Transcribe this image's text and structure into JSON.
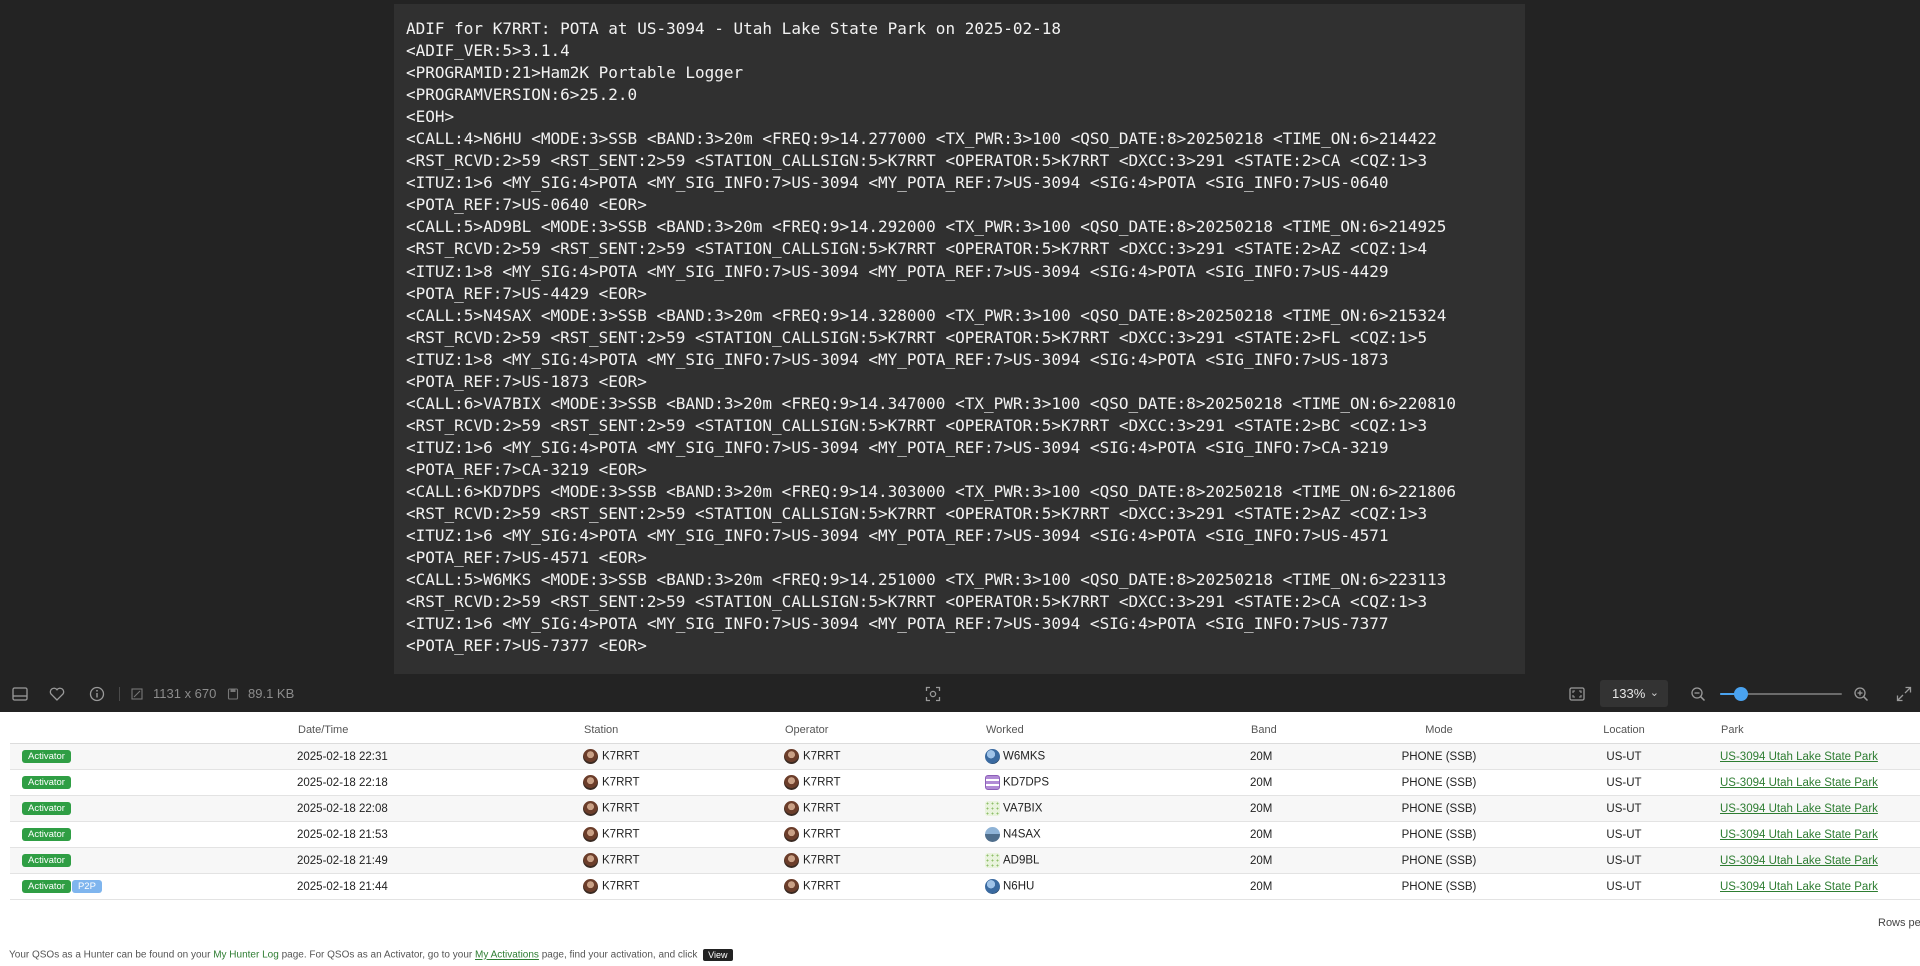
{
  "adif_lines": [
    "ADIF for K7RRT: POTA at US-3094 - Utah Lake State Park on 2025-02-18",
    "<ADIF_VER:5>3.1.4",
    "<PROGRAMID:21>Ham2K Portable Logger",
    "<PROGRAMVERSION:6>25.2.0",
    "<EOH>",
    "<CALL:4>N6HU <MODE:3>SSB <BAND:3>20m <FREQ:9>14.277000 <TX_PWR:3>100 <QSO_DATE:8>20250218 <TIME_ON:6>214422",
    "<RST_RCVD:2>59 <RST_SENT:2>59 <STATION_CALLSIGN:5>K7RRT <OPERATOR:5>K7RRT <DXCC:3>291 <STATE:2>CA <CQZ:1>3",
    "<ITUZ:1>6 <MY_SIG:4>POTA <MY_SIG_INFO:7>US-3094 <MY_POTA_REF:7>US-3094 <SIG:4>POTA <SIG_INFO:7>US-0640",
    "<POTA_REF:7>US-0640 <EOR>",
    "<CALL:5>AD9BL <MODE:3>SSB <BAND:3>20m <FREQ:9>14.292000 <TX_PWR:3>100 <QSO_DATE:8>20250218 <TIME_ON:6>214925",
    "<RST_RCVD:2>59 <RST_SENT:2>59 <STATION_CALLSIGN:5>K7RRT <OPERATOR:5>K7RRT <DXCC:3>291 <STATE:2>AZ <CQZ:1>4",
    "<ITUZ:1>8 <MY_SIG:4>POTA <MY_SIG_INFO:7>US-3094 <MY_POTA_REF:7>US-3094 <SIG:4>POTA <SIG_INFO:7>US-4429",
    "<POTA_REF:7>US-4429 <EOR>",
    "<CALL:5>N4SAX <MODE:3>SSB <BAND:3>20m <FREQ:9>14.328000 <TX_PWR:3>100 <QSO_DATE:8>20250218 <TIME_ON:6>215324",
    "<RST_RCVD:2>59 <RST_SENT:2>59 <STATION_CALLSIGN:5>K7RRT <OPERATOR:5>K7RRT <DXCC:3>291 <STATE:2>FL <CQZ:1>5",
    "<ITUZ:1>8 <MY_SIG:4>POTA <MY_SIG_INFO:7>US-3094 <MY_POTA_REF:7>US-3094 <SIG:4>POTA <SIG_INFO:7>US-1873",
    "<POTA_REF:7>US-1873 <EOR>",
    "<CALL:6>VA7BIX <MODE:3>SSB <BAND:3>20m <FREQ:9>14.347000 <TX_PWR:3>100 <QSO_DATE:8>20250218 <TIME_ON:6>220810",
    "<RST_RCVD:2>59 <RST_SENT:2>59 <STATION_CALLSIGN:5>K7RRT <OPERATOR:5>K7RRT <DXCC:3>291 <STATE:2>BC <CQZ:1>3",
    "<ITUZ:1>6 <MY_SIG:4>POTA <MY_SIG_INFO:7>US-3094 <MY_POTA_REF:7>US-3094 <SIG:4>POTA <SIG_INFO:7>CA-3219",
    "<POTA_REF:7>CA-3219 <EOR>",
    "<CALL:6>KD7DPS <MODE:3>SSB <BAND:3>20m <FREQ:9>14.303000 <TX_PWR:3>100 <QSO_DATE:8>20250218 <TIME_ON:6>221806",
    "<RST_RCVD:2>59 <RST_SENT:2>59 <STATION_CALLSIGN:5>K7RRT <OPERATOR:5>K7RRT <DXCC:3>291 <STATE:2>AZ <CQZ:1>3",
    "<ITUZ:1>6 <MY_SIG:4>POTA <MY_SIG_INFO:7>US-3094 <MY_POTA_REF:7>US-3094 <SIG:4>POTA <SIG_INFO:7>US-4571",
    "<POTA_REF:7>US-4571 <EOR>",
    "<CALL:5>W6MKS <MODE:3>SSB <BAND:3>20m <FREQ:9>14.251000 <TX_PWR:3>100 <QSO_DATE:8>20250218 <TIME_ON:6>223113",
    "<RST_RCVD:2>59 <RST_SENT:2>59 <STATION_CALLSIGN:5>K7RRT <OPERATOR:5>K7RRT <DXCC:3>291 <STATE:2>CA <CQZ:1>3",
    "<ITUZ:1>6 <MY_SIG:4>POTA <MY_SIG_INFO:7>US-3094 <MY_POTA_REF:7>US-3094 <SIG:4>POTA <SIG_INFO:7>US-7377",
    "<POTA_REF:7>US-7377 <EOR>"
  ],
  "viewer_toolbar": {
    "dimensions": "1131 x 670",
    "file_size": "89.1 KB",
    "zoom_label": "133%",
    "zoom_level_fraction": 0.17
  },
  "table": {
    "headers": {
      "type": "",
      "datetime": "Date/Time",
      "station": "Station",
      "operator": "Operator",
      "worked": "Worked",
      "band": "Band",
      "mode": "Mode",
      "location": "Location",
      "park": "Park"
    },
    "rows": [
      {
        "badges": [
          "Activator"
        ],
        "datetime": "2025-02-18 22:31",
        "station": "K7RRT",
        "operator": "K7RRT",
        "worked": "W6MKS",
        "worked_icon": "globe-icon",
        "band": "20M",
        "mode": "PHONE (SSB)",
        "location": "US-UT",
        "park": "US-3094 Utah Lake State Park"
      },
      {
        "badges": [
          "Activator"
        ],
        "datetime": "2025-02-18 22:18",
        "station": "K7RRT",
        "operator": "K7RRT",
        "worked": "KD7DPS",
        "worked_icon": "grid-icon",
        "band": "20M",
        "mode": "PHONE (SSB)",
        "location": "US-UT",
        "park": "US-3094 Utah Lake State Park"
      },
      {
        "badges": [
          "Activator"
        ],
        "datetime": "2025-02-18 22:08",
        "station": "K7RRT",
        "operator": "K7RRT",
        "worked": "VA7BIX",
        "worked_icon": "pattern-icon",
        "band": "20M",
        "mode": "PHONE (SSB)",
        "location": "US-UT",
        "park": "US-3094 Utah Lake State Park"
      },
      {
        "badges": [
          "Activator"
        ],
        "datetime": "2025-02-18 21:53",
        "station": "K7RRT",
        "operator": "K7RRT",
        "worked": "N4SAX",
        "worked_icon": "photo-icon",
        "band": "20M",
        "mode": "PHONE (SSB)",
        "location": "US-UT",
        "park": "US-3094 Utah Lake State Park"
      },
      {
        "badges": [
          "Activator"
        ],
        "datetime": "2025-02-18 21:49",
        "station": "K7RRT",
        "operator": "K7RRT",
        "worked": "AD9BL",
        "worked_icon": "pattern-icon",
        "band": "20M",
        "mode": "PHONE (SSB)",
        "location": "US-UT",
        "park": "US-3094 Utah Lake State Park"
      },
      {
        "badges": [
          "Activator",
          "P2P"
        ],
        "datetime": "2025-02-18 21:44",
        "station": "K7RRT",
        "operator": "K7RRT",
        "worked": "N6HU",
        "worked_icon": "globe-icon",
        "band": "20M",
        "mode": "PHONE (SSB)",
        "location": "US-UT",
        "park": "US-3094 Utah Lake State Park"
      }
    ]
  },
  "rows_per_page_label": "Rows per",
  "footer": {
    "part1": "Your QSOs as a Hunter can be found on your ",
    "link1": "My Hunter Log",
    "part2": " page. For QSOs as an Activator, go to your ",
    "link2": "My Activations",
    "part3": " page, find your activation, and click ",
    "chip": "View"
  },
  "colors": {
    "viewer_bg": "#232323",
    "activator_badge": "#2f9e44",
    "p2p_badge": "#7fb5ee",
    "park_link": "#2e7d32",
    "zoom_accent": "#4aa3f0"
  }
}
